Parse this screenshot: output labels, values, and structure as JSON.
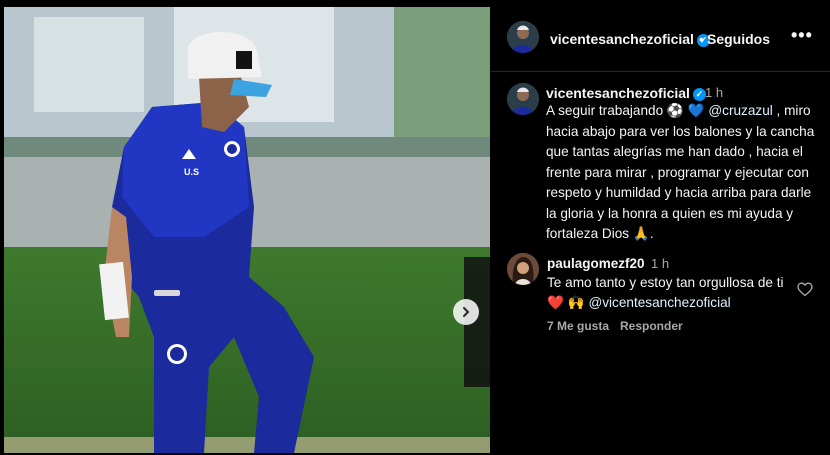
{
  "post": {
    "header": {
      "username": "vicentesanchezoficial",
      "separator": "•",
      "follow_status": "Seguidos",
      "more_icon": "more-horizontal-icon"
    },
    "caption": {
      "username": "vicentesanchezoficial",
      "time": "1 h",
      "text_part1": "A seguir trabajando ",
      "emoji1": "⚽",
      "emoji2": "💙",
      "mention": "@cruzazul",
      "text_part2": " , miro hacia abajo para ver los balones y la cancha que tantas alegrías me han dado , hacia el frente para mirar , programar y ejecutar con respeto y humildad y hacia arriba para darle la gloria y la honra a quien es mi ayuda y fortaleza Dios ",
      "emoji3": "🙏",
      "text_part3": "."
    },
    "comment": {
      "username": "paulagomezf20",
      "time": "1 h",
      "text": "Te amo tanto y estoy tan orgullosa de ti ",
      "emoji_heart": "❤️",
      "emoji_hands": "🙌",
      "mention": "@vicentesanchezoficial",
      "likes": "7 Me gusta",
      "reply": "Responder"
    },
    "photo": {
      "shirt_initials": "U.S",
      "carousel_next_icon": "chevron-right-icon"
    }
  },
  "colors": {
    "background": "#000000",
    "verified": "#0095f6",
    "muted_text": "#a8a8a8"
  }
}
